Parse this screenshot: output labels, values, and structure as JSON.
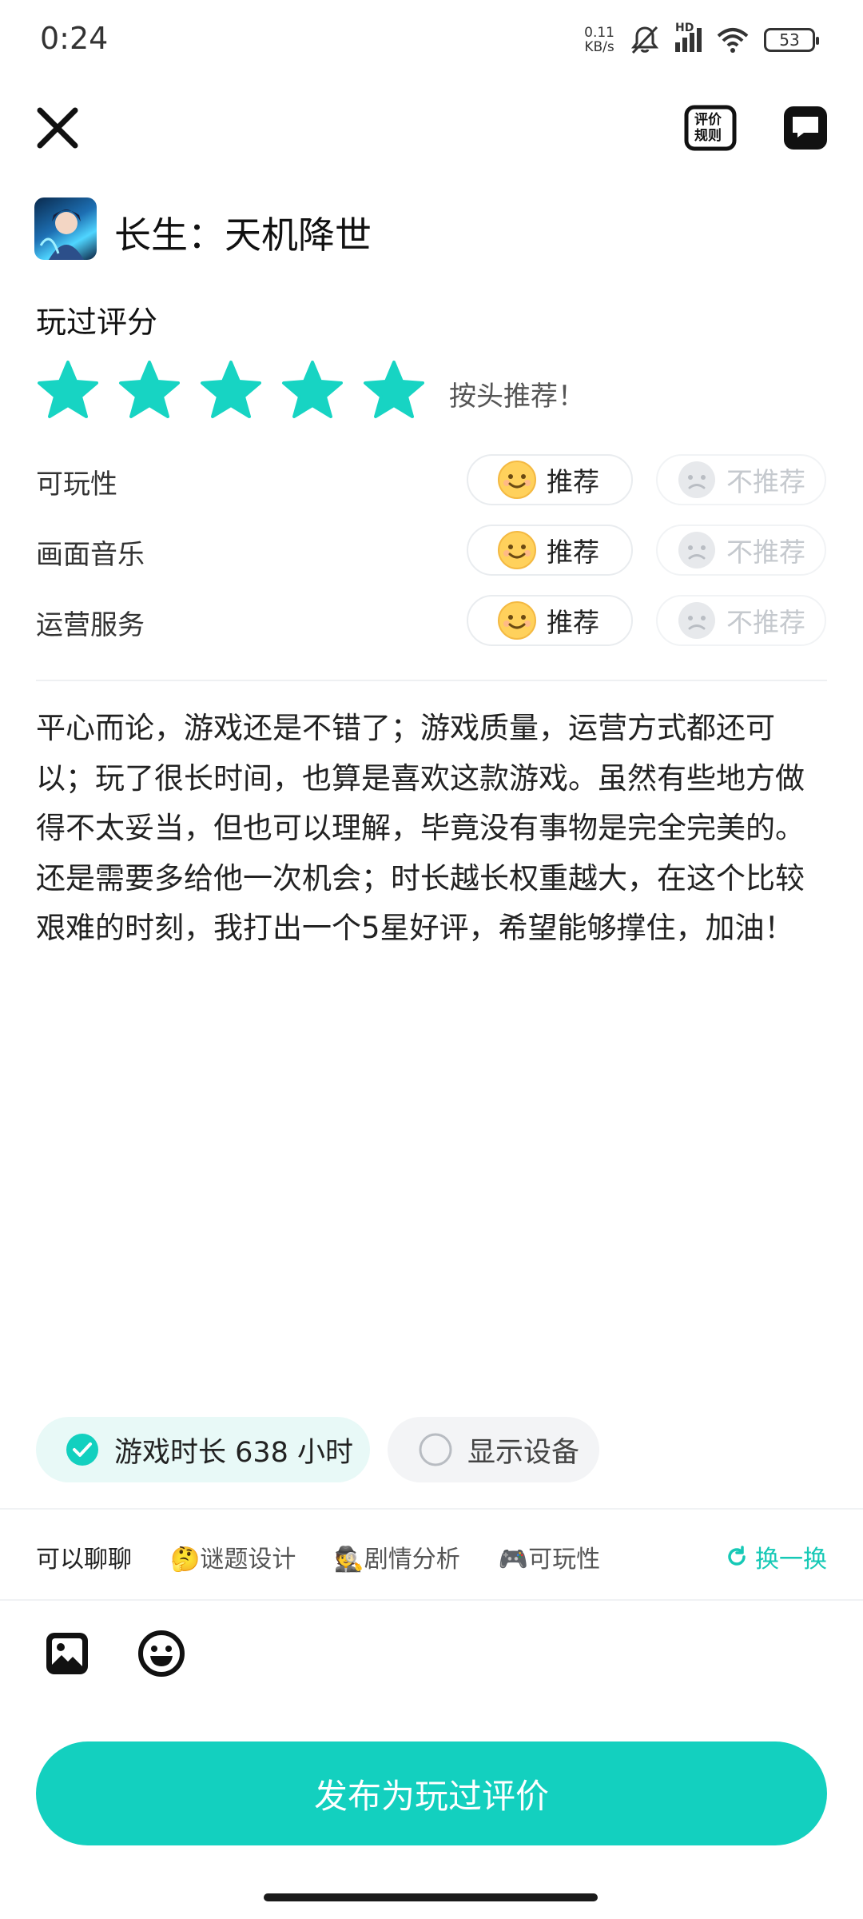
{
  "status_bar": {
    "time": "0:24",
    "net_speed_value": "0.11",
    "net_speed_unit": "KB/s",
    "signal_label": "HD",
    "battery": "53"
  },
  "header": {
    "rules_line1": "评价",
    "rules_line2": "规则"
  },
  "game": {
    "title": "长生：天机降世"
  },
  "rating": {
    "section_title": "玩过评分",
    "stars": 5,
    "max_stars": 5,
    "star_color": "#17d4c3",
    "text": "按头推荐！"
  },
  "categories": [
    {
      "label": "可玩性",
      "recommend": "推荐",
      "not_recommend": "不推荐"
    },
    {
      "label": "画面音乐",
      "recommend": "推荐",
      "not_recommend": "不推荐"
    },
    {
      "label": "运营服务",
      "recommend": "推荐",
      "not_recommend": "不推荐"
    }
  ],
  "review": {
    "text": "平心而论，游戏还是不错了；游戏质量，运营方式都还可以；玩了很长时间，也算是喜欢这款游戏。虽然有些地方做得不太妥当，但也可以理解，毕竟没有事物是完全完美的。还是需要多给他一次机会；时长越长权重越大，在这个比较艰难的时刻，我打出一个5星好评，希望能够撑住，加油！"
  },
  "chips": {
    "play_time": "游戏时长 638 小时",
    "show_device": "显示设备"
  },
  "tags": {
    "first": "可以聊聊",
    "items": [
      "🤔谜题设计",
      "🕵剧情分析",
      "🎮可玩性"
    ],
    "swap": "换一换"
  },
  "publish_button": "发布为玩过评价",
  "colors": {
    "accent": "#13d0bf",
    "chip_bg": "#e8f9f7"
  }
}
